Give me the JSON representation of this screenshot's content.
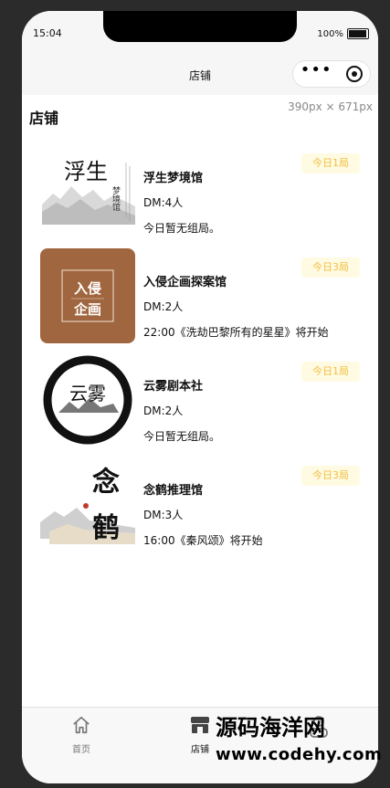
{
  "status": {
    "time": "15:04",
    "battery": "100%"
  },
  "navbar": {
    "title": "店铺"
  },
  "header": {
    "title": "店铺",
    "dimensions": "390px × 671px"
  },
  "stores": [
    {
      "name": "浮生梦境馆",
      "dm": "DM:4人",
      "note": "今日暂无组局。",
      "badge": "今日1局"
    },
    {
      "name": "入侵企画探案馆",
      "dm": "DM:2人",
      "note": "22:00《洗劫巴黎所有的星星》将开始",
      "badge": "今日3局"
    },
    {
      "name": "云雾剧本社",
      "dm": "DM:2人",
      "note": "今日暂无组局。",
      "badge": "今日1局"
    },
    {
      "name": "念鹤推理馆",
      "dm": "DM:3人",
      "note": "16:00《秦风颂》将开始",
      "badge": "今日3局"
    }
  ],
  "logos": {
    "fusheng": "浮生",
    "fusheng_sub": "梦境馆",
    "ruqin": [
      "入侵",
      "企画"
    ],
    "yunwu": "云雾",
    "nianhe": [
      "念",
      "鹤"
    ]
  },
  "tabbar": {
    "items": [
      {
        "label": "首页",
        "icon": "home-icon"
      },
      {
        "label": "店铺",
        "icon": "store-icon"
      },
      {
        "label": "",
        "icon": "user-icon"
      }
    ]
  },
  "watermark": {
    "line1": "源码海洋网",
    "line2": "www.codehy.com"
  },
  "colors": {
    "badge_bg": "#fffbe3",
    "badge_text": "#f0bf42",
    "logo_brown": "#a0663f"
  }
}
